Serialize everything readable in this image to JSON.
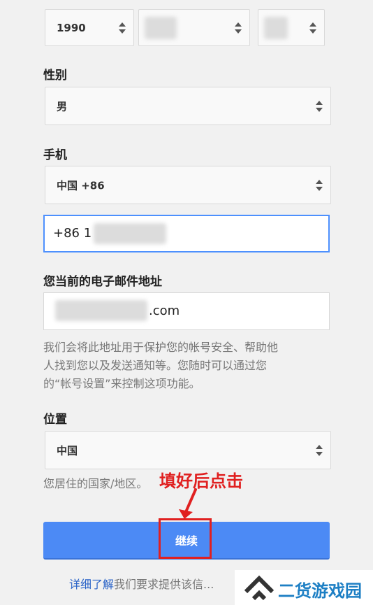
{
  "birth": {
    "year": "1990"
  },
  "gender": {
    "label": "性别",
    "value": "男"
  },
  "phone": {
    "label": "手机",
    "country": "中国 +86",
    "number": "+86 1"
  },
  "email": {
    "label": "您当前的电子邮件地址",
    "value_suffix": ".com",
    "help": [
      "我们会将此地址用于保护您的帐号安全、帮助他",
      "人找到您以及发送通知等。您随时可以通过您",
      "的“帐号设置”来控制这项功能。"
    ]
  },
  "location": {
    "label": "位置",
    "value": "中国",
    "help": "您居住的国家/地区。"
  },
  "annotation": {
    "text": "填好后点击"
  },
  "continue_button": {
    "label": "继续"
  },
  "footer": {
    "link": "详细了解",
    "text": "我们要求提供该信..."
  },
  "watermark": {
    "text": "二货游戏园"
  },
  "colors": {
    "button": "#4c8af5",
    "annotation": "#e02020",
    "focus": "#4d90fe",
    "link": "#2a63c7"
  }
}
